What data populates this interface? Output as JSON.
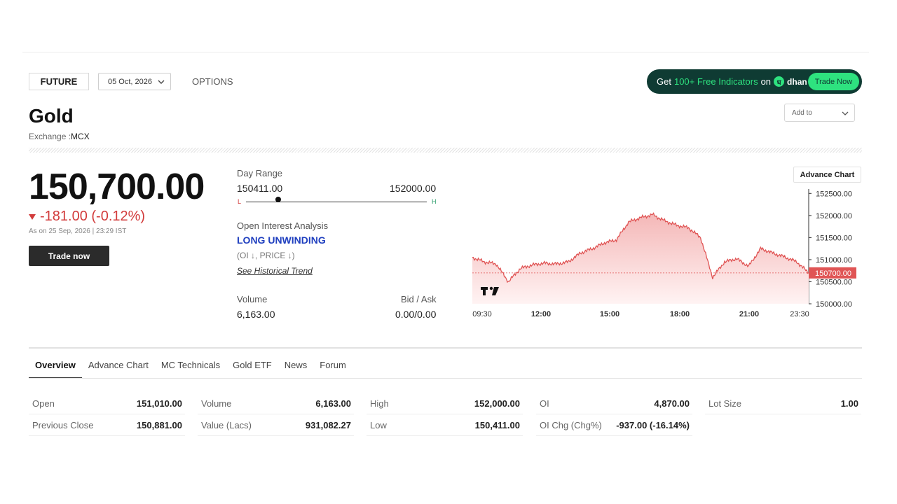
{
  "header": {
    "future_tab": "FUTURE",
    "expiry_date": "05 Oct, 2026",
    "options_tab": "OPTIONS",
    "add_to": "Add to"
  },
  "promo": {
    "text_get": "Get",
    "text_highlight": "100+ Free Indicators",
    "text_on": "on",
    "logo_glyph": "ध",
    "brand": "dhan",
    "cta": "Trade Now"
  },
  "instrument": {
    "name": "Gold",
    "exchange_label": "Exchange :",
    "exchange": "MCX"
  },
  "quote": {
    "price": "150,700.00",
    "change": "-181.00 (-0.12%)",
    "as_on": "As on 25 Sep, 2026 | 23:29 IST",
    "trade_button": "Trade now"
  },
  "day_range": {
    "label": "Day Range",
    "low": "150411.00",
    "high": "152000.00",
    "low_char": "L",
    "high_char": "H",
    "position": 0.18
  },
  "open_interest": {
    "label": "Open Interest Analysis",
    "status": "LONG UNWINDING",
    "note": "(OI ↓, PRICE ↓)",
    "link": "See Historical Trend"
  },
  "volume": {
    "label": "Volume",
    "value": "6,163.00"
  },
  "bid_ask": {
    "label": "Bid / Ask",
    "value": "0.00/0.00"
  },
  "advance_chart_button": "Advance Chart",
  "chart_data": {
    "type": "area",
    "x_ticks": [
      "09:30",
      "12:00",
      "15:00",
      "18:00",
      "21:00",
      "23:30"
    ],
    "y_ticks": [
      "152500.00",
      "152000.00",
      "151500.00",
      "151000.00",
      "150500.00",
      "150000.00"
    ],
    "ylim": [
      150000,
      152600
    ],
    "last_price_label": "150700.00",
    "last_price": 150700,
    "colors": {
      "line": "#e05555",
      "fill_top": "#f4b7b7",
      "fill_bottom": "#fff3f3",
      "marker": "#e05555"
    },
    "x": [
      "09:30",
      "10:00",
      "10:30",
      "11:00",
      "11:30",
      "12:00",
      "12:30",
      "13:00",
      "13:30",
      "14:00",
      "14:30",
      "15:00",
      "15:30",
      "16:00",
      "16:30",
      "17:00",
      "17:30",
      "18:00",
      "18:30",
      "19:00",
      "19:30",
      "20:00",
      "20:30",
      "21:00",
      "21:30",
      "22:00",
      "22:30",
      "23:00",
      "23:30"
    ],
    "values": [
      151050,
      150950,
      150900,
      150500,
      150800,
      150880,
      150920,
      150900,
      150950,
      151150,
      151250,
      151380,
      151450,
      151850,
      151950,
      152020,
      151880,
      151780,
      151720,
      151500,
      150600,
      150950,
      151020,
      150850,
      151250,
      151150,
      151060,
      150950,
      150700
    ]
  },
  "tabs": [
    "Overview",
    "Advance Chart",
    "MC Technicals",
    "Gold ETF",
    "News",
    "Forum"
  ],
  "stats": [
    [
      {
        "k": "Open",
        "v": "151,010.00"
      },
      {
        "k": "Previous Close",
        "v": "150,881.00"
      }
    ],
    [
      {
        "k": "Volume",
        "v": "6,163.00"
      },
      {
        "k": "Value (Lacs)",
        "v": "931,082.27"
      }
    ],
    [
      {
        "k": "High",
        "v": "152,000.00"
      },
      {
        "k": "Low",
        "v": "150,411.00"
      }
    ],
    [
      {
        "k": "OI",
        "v": "4,870.00"
      },
      {
        "k": "OI Chg (Chg%)",
        "v": "-937.00 (-16.14%)"
      }
    ],
    [
      {
        "k": "Lot Size",
        "v": "1.00"
      }
    ]
  ]
}
